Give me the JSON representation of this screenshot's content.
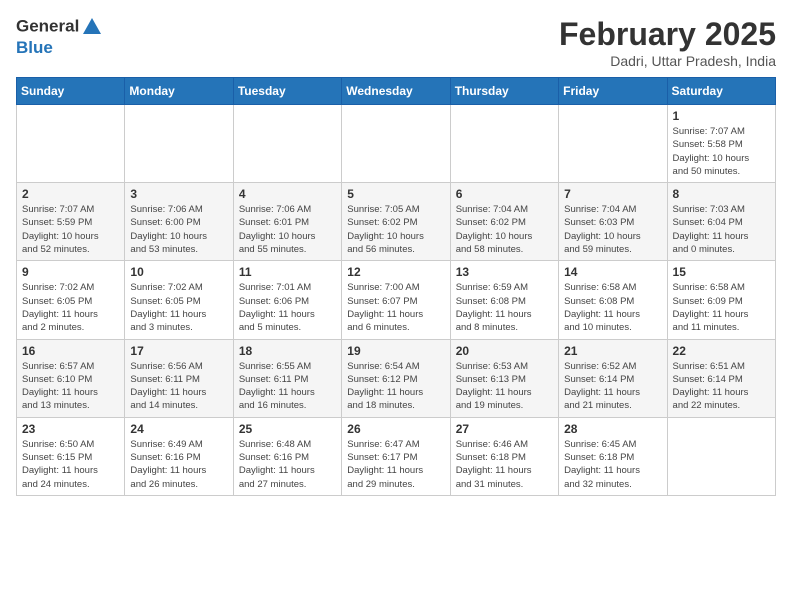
{
  "header": {
    "logo_line1": "General",
    "logo_line2": "Blue",
    "month": "February 2025",
    "location": "Dadri, Uttar Pradesh, India"
  },
  "weekdays": [
    "Sunday",
    "Monday",
    "Tuesday",
    "Wednesday",
    "Thursday",
    "Friday",
    "Saturday"
  ],
  "weeks": [
    [
      {
        "day": "",
        "info": ""
      },
      {
        "day": "",
        "info": ""
      },
      {
        "day": "",
        "info": ""
      },
      {
        "day": "",
        "info": ""
      },
      {
        "day": "",
        "info": ""
      },
      {
        "day": "",
        "info": ""
      },
      {
        "day": "1",
        "info": "Sunrise: 7:07 AM\nSunset: 5:58 PM\nDaylight: 10 hours\nand 50 minutes."
      }
    ],
    [
      {
        "day": "2",
        "info": "Sunrise: 7:07 AM\nSunset: 5:59 PM\nDaylight: 10 hours\nand 52 minutes."
      },
      {
        "day": "3",
        "info": "Sunrise: 7:06 AM\nSunset: 6:00 PM\nDaylight: 10 hours\nand 53 minutes."
      },
      {
        "day": "4",
        "info": "Sunrise: 7:06 AM\nSunset: 6:01 PM\nDaylight: 10 hours\nand 55 minutes."
      },
      {
        "day": "5",
        "info": "Sunrise: 7:05 AM\nSunset: 6:02 PM\nDaylight: 10 hours\nand 56 minutes."
      },
      {
        "day": "6",
        "info": "Sunrise: 7:04 AM\nSunset: 6:02 PM\nDaylight: 10 hours\nand 58 minutes."
      },
      {
        "day": "7",
        "info": "Sunrise: 7:04 AM\nSunset: 6:03 PM\nDaylight: 10 hours\nand 59 minutes."
      },
      {
        "day": "8",
        "info": "Sunrise: 7:03 AM\nSunset: 6:04 PM\nDaylight: 11 hours\nand 0 minutes."
      }
    ],
    [
      {
        "day": "9",
        "info": "Sunrise: 7:02 AM\nSunset: 6:05 PM\nDaylight: 11 hours\nand 2 minutes."
      },
      {
        "day": "10",
        "info": "Sunrise: 7:02 AM\nSunset: 6:05 PM\nDaylight: 11 hours\nand 3 minutes."
      },
      {
        "day": "11",
        "info": "Sunrise: 7:01 AM\nSunset: 6:06 PM\nDaylight: 11 hours\nand 5 minutes."
      },
      {
        "day": "12",
        "info": "Sunrise: 7:00 AM\nSunset: 6:07 PM\nDaylight: 11 hours\nand 6 minutes."
      },
      {
        "day": "13",
        "info": "Sunrise: 6:59 AM\nSunset: 6:08 PM\nDaylight: 11 hours\nand 8 minutes."
      },
      {
        "day": "14",
        "info": "Sunrise: 6:58 AM\nSunset: 6:08 PM\nDaylight: 11 hours\nand 10 minutes."
      },
      {
        "day": "15",
        "info": "Sunrise: 6:58 AM\nSunset: 6:09 PM\nDaylight: 11 hours\nand 11 minutes."
      }
    ],
    [
      {
        "day": "16",
        "info": "Sunrise: 6:57 AM\nSunset: 6:10 PM\nDaylight: 11 hours\nand 13 minutes."
      },
      {
        "day": "17",
        "info": "Sunrise: 6:56 AM\nSunset: 6:11 PM\nDaylight: 11 hours\nand 14 minutes."
      },
      {
        "day": "18",
        "info": "Sunrise: 6:55 AM\nSunset: 6:11 PM\nDaylight: 11 hours\nand 16 minutes."
      },
      {
        "day": "19",
        "info": "Sunrise: 6:54 AM\nSunset: 6:12 PM\nDaylight: 11 hours\nand 18 minutes."
      },
      {
        "day": "20",
        "info": "Sunrise: 6:53 AM\nSunset: 6:13 PM\nDaylight: 11 hours\nand 19 minutes."
      },
      {
        "day": "21",
        "info": "Sunrise: 6:52 AM\nSunset: 6:14 PM\nDaylight: 11 hours\nand 21 minutes."
      },
      {
        "day": "22",
        "info": "Sunrise: 6:51 AM\nSunset: 6:14 PM\nDaylight: 11 hours\nand 22 minutes."
      }
    ],
    [
      {
        "day": "23",
        "info": "Sunrise: 6:50 AM\nSunset: 6:15 PM\nDaylight: 11 hours\nand 24 minutes."
      },
      {
        "day": "24",
        "info": "Sunrise: 6:49 AM\nSunset: 6:16 PM\nDaylight: 11 hours\nand 26 minutes."
      },
      {
        "day": "25",
        "info": "Sunrise: 6:48 AM\nSunset: 6:16 PM\nDaylight: 11 hours\nand 27 minutes."
      },
      {
        "day": "26",
        "info": "Sunrise: 6:47 AM\nSunset: 6:17 PM\nDaylight: 11 hours\nand 29 minutes."
      },
      {
        "day": "27",
        "info": "Sunrise: 6:46 AM\nSunset: 6:18 PM\nDaylight: 11 hours\nand 31 minutes."
      },
      {
        "day": "28",
        "info": "Sunrise: 6:45 AM\nSunset: 6:18 PM\nDaylight: 11 hours\nand 32 minutes."
      },
      {
        "day": "",
        "info": ""
      }
    ]
  ]
}
